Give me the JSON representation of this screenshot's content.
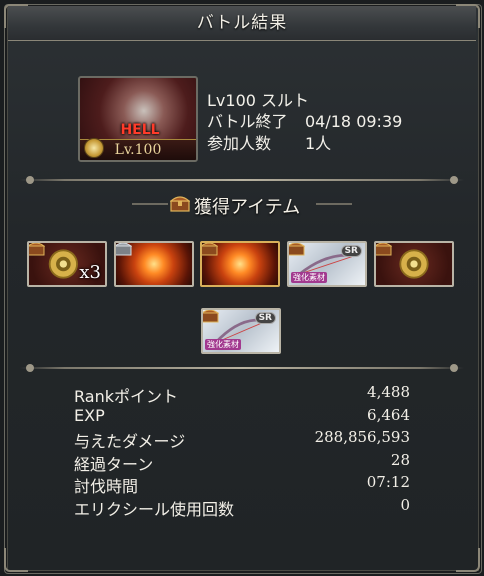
{
  "window": {
    "title": "バトル結果"
  },
  "quest": {
    "banner_text": "HELL",
    "banner_level": "Lv.100",
    "rows": [
      {
        "label": "Lv100 スルト",
        "value": ""
      },
      {
        "label": "バトル終了",
        "value": "04/18 09:39"
      },
      {
        "label": "参加人数",
        "value": "1人"
      }
    ]
  },
  "items_section": {
    "title": "獲得アイテム",
    "items": [
      {
        "name": "gold-medal",
        "qty": "x3",
        "tag": "",
        "rarity": ""
      },
      {
        "name": "fire-orb",
        "qty": "",
        "tag": "",
        "rarity": ""
      },
      {
        "name": "fire-rose",
        "qty": "",
        "tag": "",
        "rarity": ""
      },
      {
        "name": "bow-weapon",
        "qty": "",
        "tag": "強化素材",
        "rarity": "SR"
      },
      {
        "name": "gold-medal",
        "qty": "",
        "tag": "",
        "rarity": ""
      },
      {
        "name": "bow-weapon",
        "qty": "",
        "tag": "強化素材",
        "rarity": "SR"
      }
    ]
  },
  "stats": [
    {
      "label": "Rankポイント",
      "value": "4,488"
    },
    {
      "label": "EXP",
      "value": "6,464"
    },
    {
      "label": "与えたダメージ",
      "value": "288,856,593"
    },
    {
      "label": "経過ターン",
      "value": "28"
    },
    {
      "label": "討伐時間",
      "value": "07:12"
    },
    {
      "label": "エリクシール使用回数",
      "value": "0"
    }
  ],
  "colors": {
    "accent_gold": "#c79b37",
    "frame": "#8c8778",
    "tag_pink": "#a23a8f"
  }
}
